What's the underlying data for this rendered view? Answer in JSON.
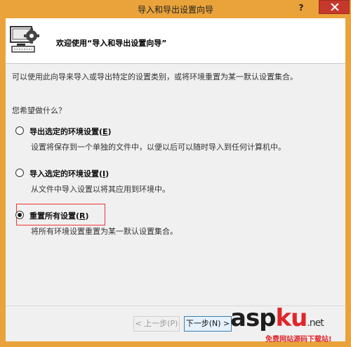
{
  "window": {
    "title": "导入和导出设置向导",
    "help_label": "?",
    "colors": {
      "frame": "#eaa33a",
      "close": "#c7382c",
      "highlight": "#e33333"
    }
  },
  "header": {
    "title": "欢迎使用“导入和导出设置向导”",
    "icon": "settings-wizard-icon"
  },
  "intro": "可以使用此向导来导入或导出特定的设置类别，或将环境重置为某一默认设置集合。",
  "question": "您希望做什么？",
  "options": [
    {
      "label": "导出选定的环境设置",
      "key": "E",
      "description": "设置将保存到一个单独的文件中，以便以后可以随时导入到任何计算机中。",
      "selected": false
    },
    {
      "label": "导入选定的环境设置",
      "key": "I",
      "description": "从文件中导入设置以将其应用到环境中。",
      "selected": false
    },
    {
      "label": "重置所有设置",
      "key": "R",
      "description": "将所有环境设置重置为某一默认设置集合。",
      "selected": true
    }
  ],
  "buttons": {
    "back": "< 上一步(P)",
    "next": "下一步(N) >"
  },
  "watermark": {
    "text_black": "asp",
    "text_red": "ku",
    "suffix": ".net",
    "subtitle": "免费网站源码下载站!"
  }
}
